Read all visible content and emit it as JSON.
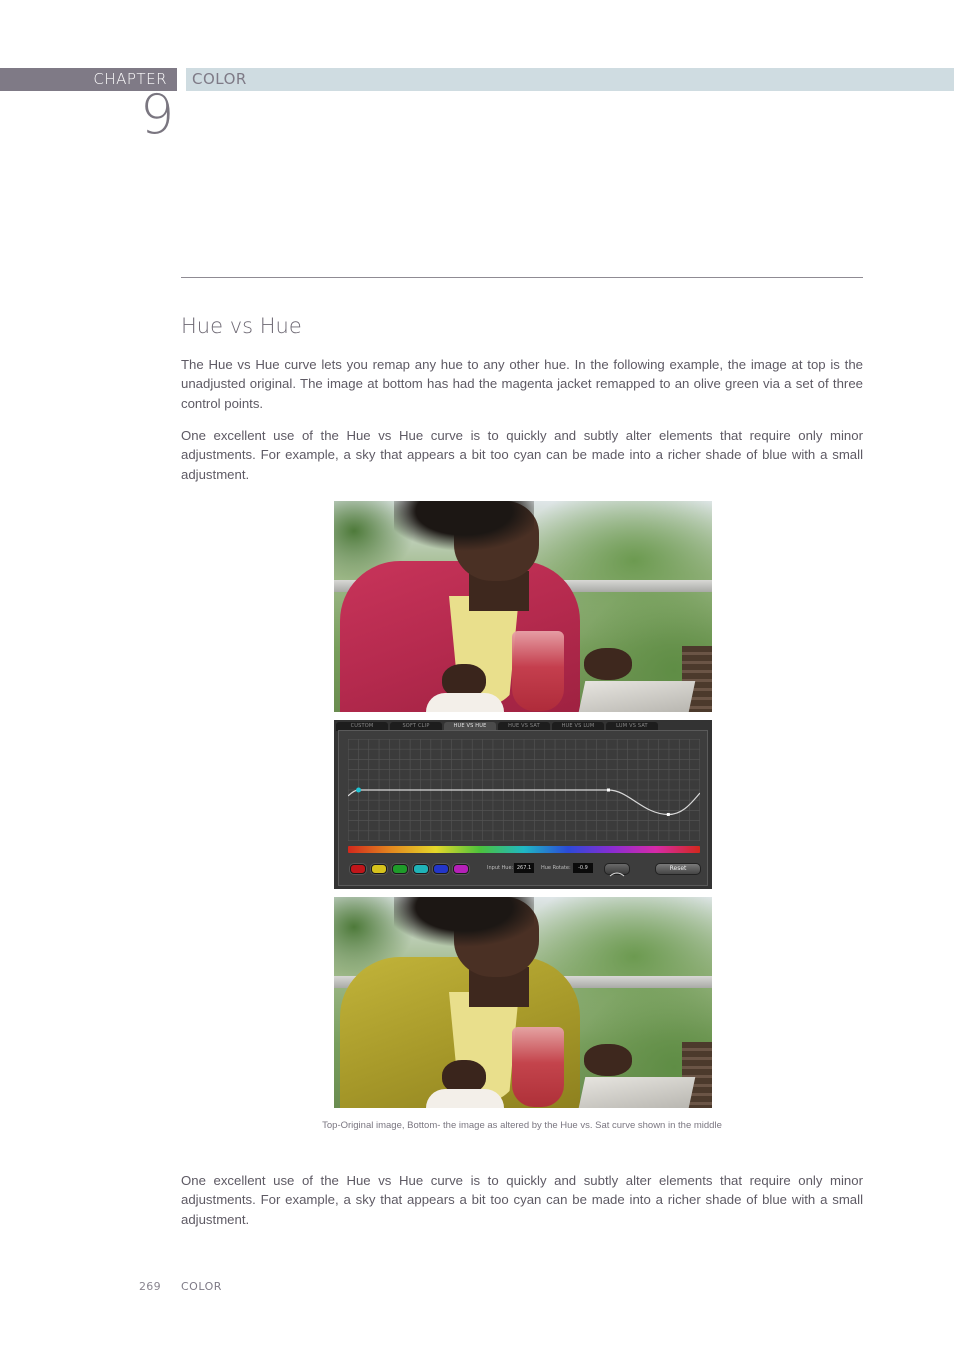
{
  "header": {
    "chapter_label": "CHAPTER",
    "chapter_number": "9",
    "chapter_title": "COLOR",
    "colors": {
      "chapter_bar": "#7f7a86",
      "title_bar": "#cfdce1"
    }
  },
  "section": {
    "heading": "Hue vs Hue",
    "paragraphs": [
      "The Hue vs Hue curve lets you remap any hue to any other hue. In the following example, the image at top is the unadjusted original. The image at bottom has had the magenta jacket remapped to an olive green via a set of three control points.",
      "One excellent use of the Hue vs Hue curve is to quickly and subtly alter elements that require only minor adjustments. For example, a sky that appears a bit too cyan can be made into a richer shade of blue with a small adjustment."
    ]
  },
  "figure": {
    "top_image_alt": "Original image: woman in magenta jacket at table with red drink",
    "bottom_image_alt": "Altered image: woman in olive green jacket at table with red drink",
    "curve_panel": {
      "tabs": [
        {
          "label": "CUSTOM",
          "active": false
        },
        {
          "label": "SOFT CLIP",
          "active": false
        },
        {
          "label": "HUE VS HUE",
          "active": true
        },
        {
          "label": "HUE VS SAT",
          "active": false
        },
        {
          "label": "HUE VS LUM",
          "active": false
        },
        {
          "label": "LUM VS SAT",
          "active": false
        }
      ],
      "swatches": [
        {
          "name": "red",
          "color": "#c0161a"
        },
        {
          "name": "yellow",
          "color": "#d6c21c"
        },
        {
          "name": "green",
          "color": "#1f9c2a"
        },
        {
          "name": "cyan",
          "color": "#1fb3b7"
        },
        {
          "name": "blue",
          "color": "#2336c9"
        },
        {
          "name": "magenta",
          "color": "#b520b8"
        }
      ],
      "input_hue_label": "Input Hue:",
      "input_hue_value": "267.1",
      "hue_rotate_label": "Hue Rotate:",
      "hue_rotate_value": "-0.9",
      "reset_label": "Reset",
      "control_points": [
        {
          "hue_fraction": 0.03,
          "offset_fraction": 0.0,
          "selected": true
        },
        {
          "hue_fraction": 0.74,
          "offset_fraction": 0.0,
          "selected": false
        },
        {
          "hue_fraction": 0.91,
          "offset_fraction": -0.24,
          "selected": false
        }
      ]
    },
    "caption": "Top-Original image, Bottom- the image as altered by the Hue vs. Sat curve shown in the middle"
  },
  "after_figure": {
    "paragraph": "One excellent use of the Hue vs Hue curve is to quickly and subtly alter elements that require only minor adjustments. For example, a sky that appears a bit too cyan can be made into a richer shade of blue with a small adjustment."
  },
  "footer": {
    "page_number": "269",
    "section_label": "COLOR"
  }
}
